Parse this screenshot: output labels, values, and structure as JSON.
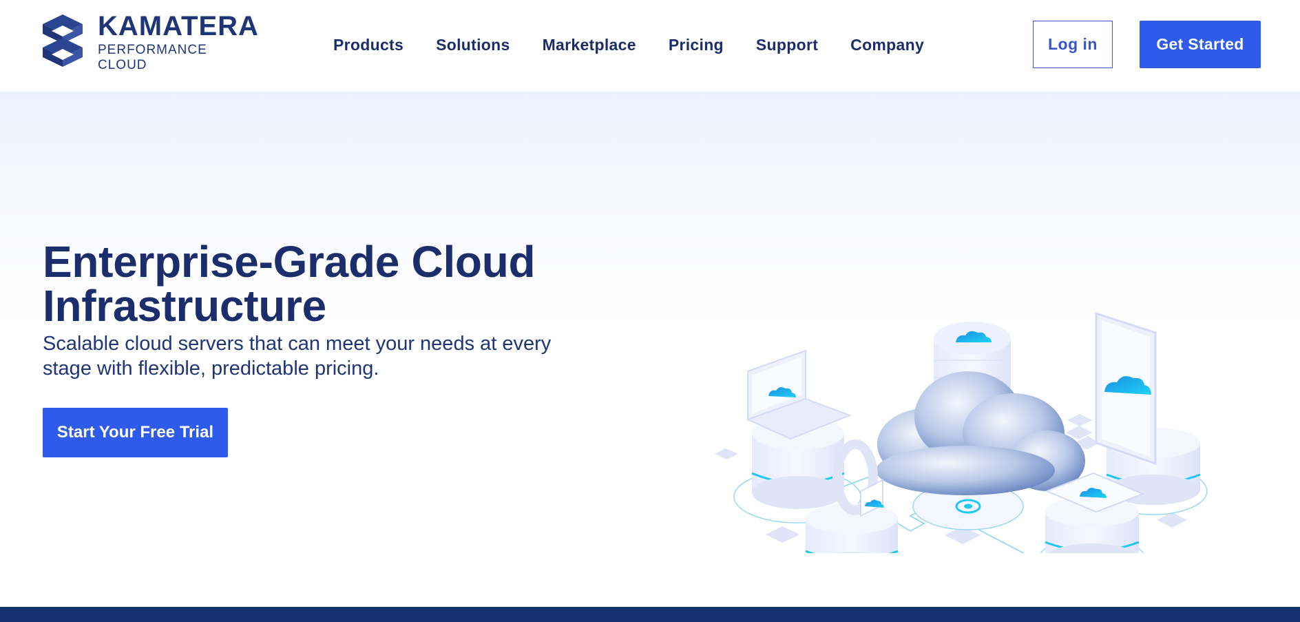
{
  "brand": {
    "name": "KAMATERA",
    "tagline": "PERFORMANCE CLOUD"
  },
  "nav": {
    "items": [
      {
        "label": "Products"
      },
      {
        "label": "Solutions"
      },
      {
        "label": "Marketplace"
      },
      {
        "label": "Pricing"
      },
      {
        "label": "Support"
      },
      {
        "label": "Company"
      }
    ]
  },
  "header": {
    "login_label": "Log in",
    "get_started_label": "Get Started"
  },
  "hero": {
    "title": "Enterprise-Grade Cloud Infrastructure",
    "subtitle": "Scalable cloud servers that can meet your needs at every stage with flexible, predictable pricing.",
    "cta_label": "Start Your Free Trial"
  },
  "colors": {
    "primary": "#2f5bea",
    "navy": "#1b2e6b",
    "footer_band": "#13306f",
    "accent_cyan": "#1ec8f0"
  },
  "icons": {
    "logo": "kamatera-logo-icon",
    "illustration": "cloud-infrastructure-illustration"
  }
}
